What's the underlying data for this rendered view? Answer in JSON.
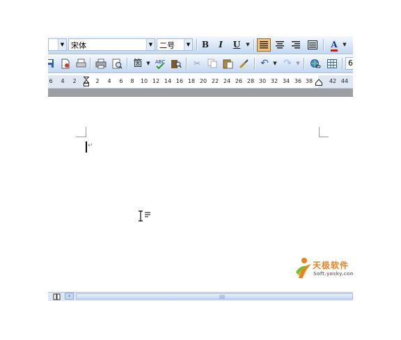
{
  "formatting_toolbar": {
    "style_value": "",
    "font_value": "宋体",
    "size_value": "二号",
    "bold_label": "B",
    "italic_label": "I",
    "underline_label": "U",
    "font_color_label": "A"
  },
  "standard_toolbar": {
    "zoom_value": "6"
  },
  "ruler": {
    "ticks_left": [
      "6",
      "4",
      "2"
    ],
    "ticks_right": [
      "2",
      "4",
      "6",
      "8",
      "10",
      "12",
      "14",
      "16",
      "18",
      "20",
      "22",
      "24",
      "26",
      "28",
      "30",
      "32",
      "34",
      "36",
      "38",
      "42",
      "44"
    ]
  },
  "document": {
    "paragraph_mark": "↵"
  },
  "watermark": {
    "brand": "天极软件",
    "url": "Soft.yesky.com"
  },
  "colors": {
    "toolbar_light": "#f3f8fe",
    "toolbar_dark": "#c3d8f1",
    "active_button": "#f8c073",
    "logo_orange": "#f07f1c",
    "logo_green": "#7bbf2a"
  }
}
